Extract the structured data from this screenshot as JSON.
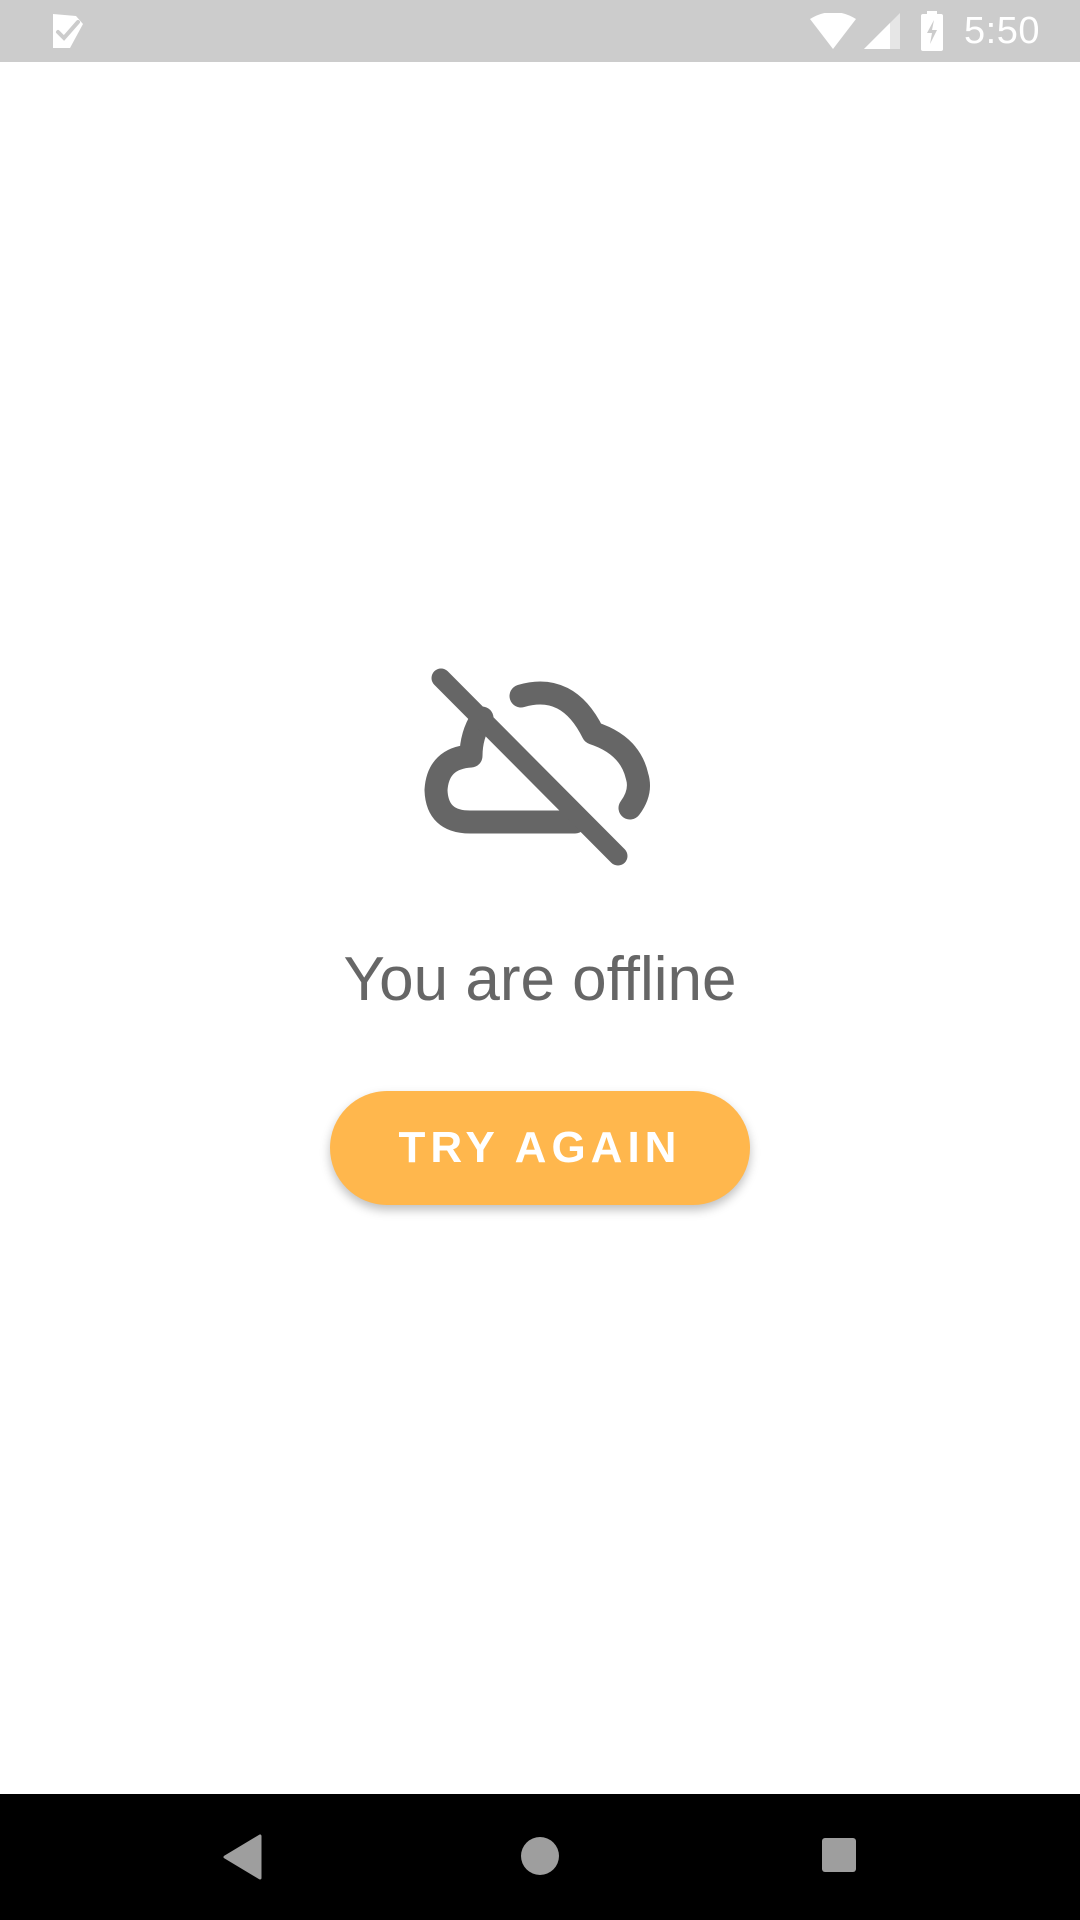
{
  "status_bar": {
    "time": "5:50",
    "background_color": "#cccccc",
    "icons": [
      "task-check-icon",
      "wifi-icon",
      "cellular-signal-icon",
      "battery-charging-icon"
    ]
  },
  "main": {
    "icon": "cloud-off-icon",
    "icon_color": "#666666",
    "message": "You are offline",
    "button_label": "TRY AGAIN",
    "button_color": "#FFB74D"
  },
  "nav_bar": {
    "icons": [
      "back-icon",
      "home-icon",
      "recents-icon"
    ],
    "background_color": "#000000"
  }
}
